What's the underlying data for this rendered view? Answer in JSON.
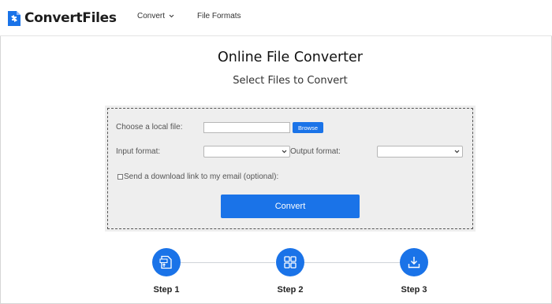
{
  "header": {
    "logo_text": "ConvertFiles",
    "nav": {
      "convert_label": "Convert",
      "formats_label": "File Formats"
    }
  },
  "main": {
    "title": "Online File Converter",
    "subtitle": "Select Files to Convert"
  },
  "converter": {
    "choose_file_label": "Choose a local file:",
    "file_input_value": "",
    "browse_label": "Browse",
    "input_format_label": "Input format:",
    "input_format_value": "",
    "output_format_label": "Output format:",
    "output_format_value": "",
    "email_checkbox_label": "Send a download link to my email (optional):",
    "email_checked": false,
    "convert_label": "Convert"
  },
  "steps": [
    {
      "label": "Step 1",
      "icon": "file-upload-icon"
    },
    {
      "label": "Step 2",
      "icon": "grid-icon"
    },
    {
      "label": "Step 3",
      "icon": "download-icon"
    }
  ],
  "colors": {
    "accent": "#1a73e8",
    "converter_bg": "#eeeeee"
  }
}
